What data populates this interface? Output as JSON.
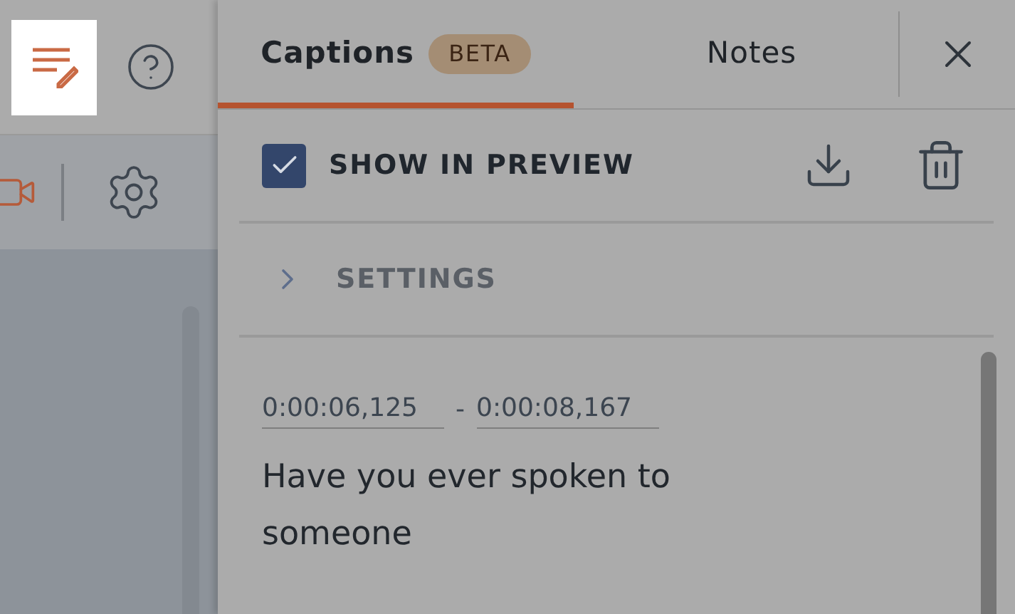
{
  "tabs": [
    {
      "label": "Captions",
      "badge": "BETA",
      "selected": true
    },
    {
      "label": "Notes",
      "selected": false
    }
  ],
  "show_in_preview": {
    "label": "SHOW IN PREVIEW",
    "checked": true
  },
  "settings": {
    "label": "SETTINGS",
    "expanded": false
  },
  "caption": {
    "start": "0:00:06,125",
    "separator": "-",
    "end": "0:00:08,167",
    "text": "Have you ever spoken to someone"
  }
}
